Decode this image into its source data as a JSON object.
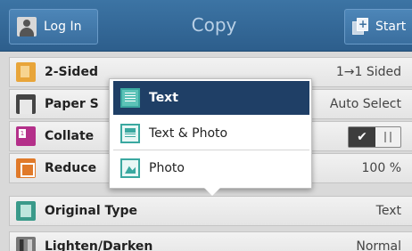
{
  "header": {
    "login_label": "Log In",
    "title": "Copy",
    "start_label": "Start"
  },
  "rows": [
    {
      "label": "2-Sided",
      "value": "1→1 Sided",
      "icon": "two-sided-icon"
    },
    {
      "label": "Paper S",
      "value": "Auto Select",
      "icon": "paper-supply-icon"
    },
    {
      "label": "Collate",
      "value": "",
      "icon": "collate-icon"
    },
    {
      "label": "Reduce",
      "value": "100 %",
      "icon": "reduce-enlarge-icon"
    },
    {
      "label": "Original Type",
      "value": "Text",
      "icon": "original-type-icon"
    },
    {
      "label": "Lighten/Darken",
      "value": "Normal",
      "icon": "lighten-darken-icon"
    }
  ],
  "collate_toggle": {
    "state": "on",
    "on_symbol": "✔"
  },
  "popup": {
    "options": [
      {
        "label": "Text",
        "selected": true,
        "icon": "text-icon"
      },
      {
        "label": "Text & Photo",
        "selected": false,
        "icon": "text-photo-icon"
      },
      {
        "label": "Photo",
        "selected": false,
        "icon": "photo-icon"
      }
    ]
  },
  "colors": {
    "header": "#2d5e8c",
    "selected": "#1f3f66",
    "accent_teal": "#3aa8a0"
  }
}
